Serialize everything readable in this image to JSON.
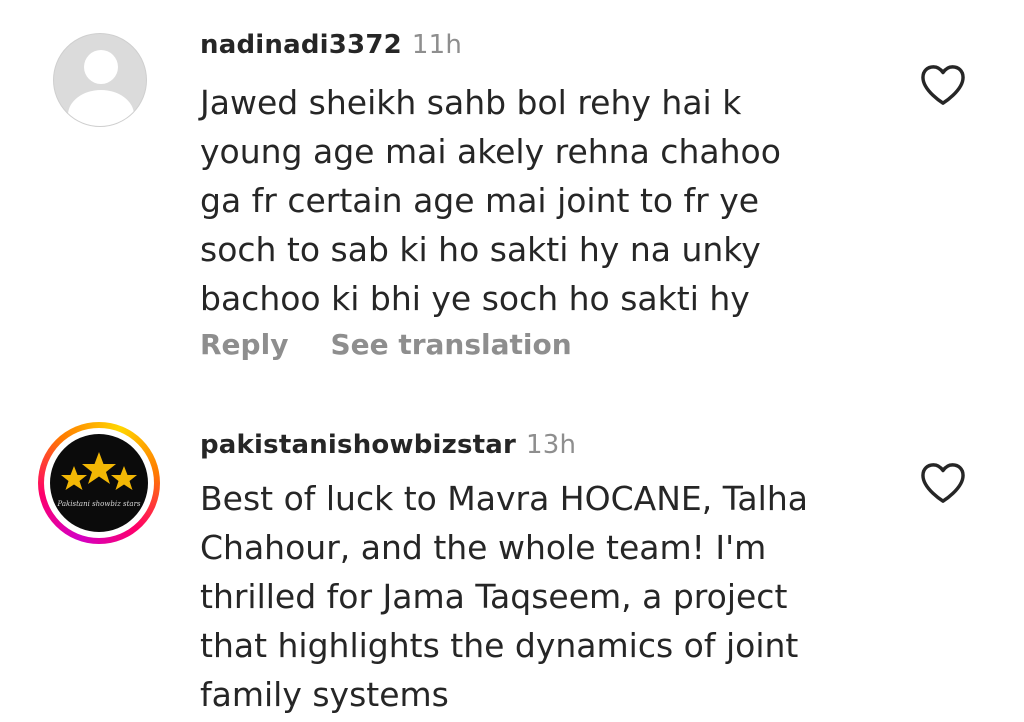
{
  "comments": [
    {
      "username": "nadinadi3372",
      "time": "11h",
      "lines": [
        "Jawed sheikh sahb bol rehy hai k",
        "young age mai akely rehna chahoo",
        "ga fr certain age mai joint to fr ye",
        "soch to sab ki ho sakti hy na unky",
        "bachoo ki bhi ye soch ho sakti hy"
      ],
      "reply_label": "Reply",
      "translate_label": "See translation",
      "avatar_icon": "default-profile-icon"
    },
    {
      "username": "pakistanishowbizstar",
      "time": "13h",
      "lines": [
        "Best of luck to Mavra HOCANE, Talha",
        "Chahour, and the whole team! I'm",
        "thrilled for Jama Taqseem, a project",
        "that highlights the dynamics of joint",
        "family systems"
      ],
      "avatar_icon": "three-stars-logo",
      "avatar_script_text": "Pakistani showbiz stars"
    }
  ],
  "icons": {
    "like": "heart-outline-icon"
  },
  "colors": {
    "text": "#262626",
    "muted": "#8e8e8e",
    "star_gold": "#f2b705"
  }
}
